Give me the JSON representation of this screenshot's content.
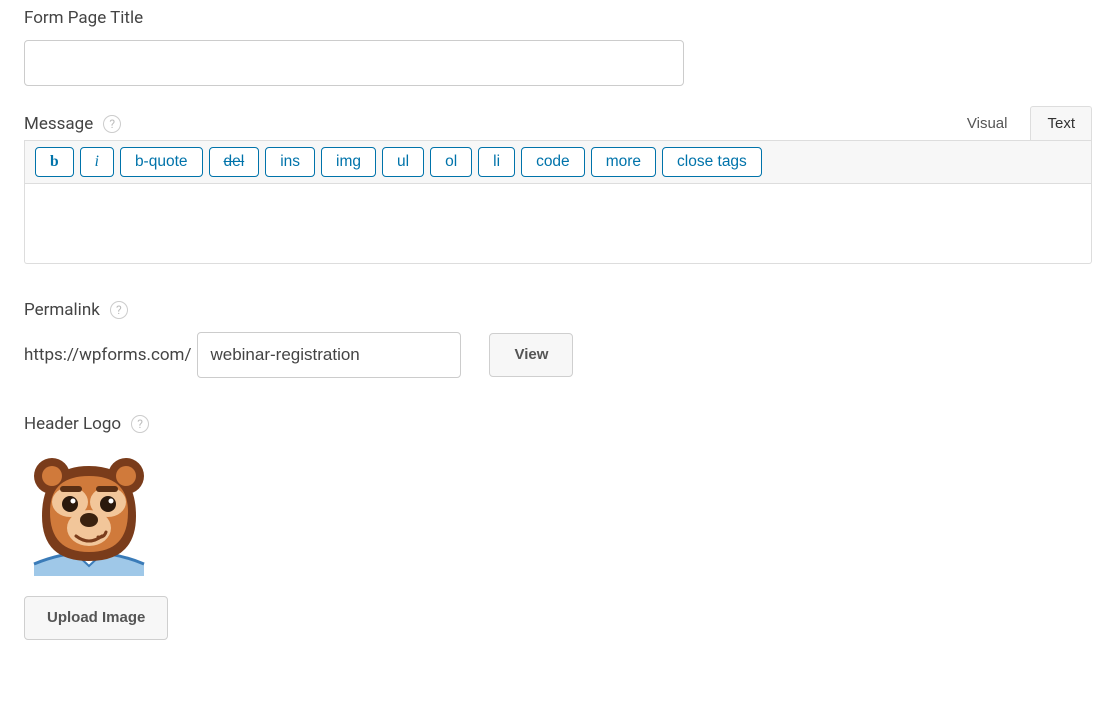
{
  "fields": {
    "title": {
      "label": "Form Page Title",
      "value": ""
    },
    "message": {
      "label": "Message",
      "tabs": {
        "visual": "Visual",
        "text": "Text",
        "active": "text"
      },
      "quicktags": [
        {
          "key": "b",
          "label": "b",
          "style": "bold"
        },
        {
          "key": "i",
          "label": "i",
          "style": "italic"
        },
        {
          "key": "bquote",
          "label": "b-quote",
          "style": ""
        },
        {
          "key": "del",
          "label": "del",
          "style": "strike"
        },
        {
          "key": "ins",
          "label": "ins",
          "style": ""
        },
        {
          "key": "img",
          "label": "img",
          "style": ""
        },
        {
          "key": "ul",
          "label": "ul",
          "style": ""
        },
        {
          "key": "ol",
          "label": "ol",
          "style": ""
        },
        {
          "key": "li",
          "label": "li",
          "style": ""
        },
        {
          "key": "code",
          "label": "code",
          "style": ""
        },
        {
          "key": "more",
          "label": "more",
          "style": ""
        },
        {
          "key": "close",
          "label": "close tags",
          "style": ""
        }
      ],
      "content": ""
    },
    "permalink": {
      "label": "Permalink",
      "prefix": "https://wpforms.com/",
      "slug": "webinar-registration",
      "view_label": "View"
    },
    "header_logo": {
      "label": "Header Logo",
      "upload_label": "Upload Image"
    }
  }
}
